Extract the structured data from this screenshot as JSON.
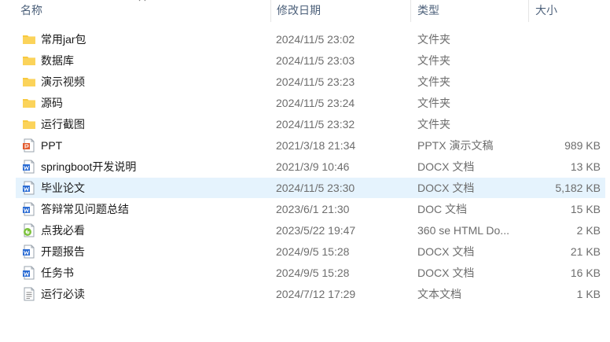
{
  "columns": {
    "name": "名称",
    "date": "修改日期",
    "type": "类型",
    "size": "大小"
  },
  "icons": {
    "folder": "folder-icon",
    "pptx": "pptx-file-icon",
    "docx": "docx-file-icon",
    "doc": "doc-file-icon",
    "html": "html-file-icon",
    "txt": "text-file-icon",
    "sort": "sort-up-icon"
  },
  "colors": {
    "selected_row": "#e5f3fd",
    "folder": "#f8c93e",
    "word": "#2b6cd4",
    "ppt": "#e35b2e",
    "html": "#7cc23c"
  },
  "files": [
    {
      "name": "常用jar包",
      "date": "2024/11/5 23:02",
      "type": "文件夹",
      "size": "",
      "kind": "folder",
      "selected": false
    },
    {
      "name": "数据库",
      "date": "2024/11/5 23:03",
      "type": "文件夹",
      "size": "",
      "kind": "folder",
      "selected": false
    },
    {
      "name": "演示视频",
      "date": "2024/11/5 23:23",
      "type": "文件夹",
      "size": "",
      "kind": "folder",
      "selected": false
    },
    {
      "name": "源码",
      "date": "2024/11/5 23:24",
      "type": "文件夹",
      "size": "",
      "kind": "folder",
      "selected": false
    },
    {
      "name": "运行截图",
      "date": "2024/11/5 23:32",
      "type": "文件夹",
      "size": "",
      "kind": "folder",
      "selected": false
    },
    {
      "name": "PPT",
      "date": "2021/3/18 21:34",
      "type": "PPTX 演示文稿",
      "size": "989 KB",
      "kind": "pptx",
      "selected": false
    },
    {
      "name": "springboot开发说明",
      "date": "2021/3/9 10:46",
      "type": "DOCX 文档",
      "size": "13 KB",
      "kind": "docx",
      "selected": false
    },
    {
      "name": "毕业论文",
      "date": "2024/11/5 23:30",
      "type": "DOCX 文档",
      "size": "5,182 KB",
      "kind": "docx",
      "selected": true
    },
    {
      "name": "答辩常见问题总结",
      "date": "2023/6/1 21:30",
      "type": "DOC 文档",
      "size": "15 KB",
      "kind": "doc",
      "selected": false
    },
    {
      "name": "点我必看",
      "date": "2023/5/22 19:47",
      "type": "360 se HTML Do...",
      "size": "2 KB",
      "kind": "html",
      "selected": false
    },
    {
      "name": "开题报告",
      "date": "2024/9/5 15:28",
      "type": "DOCX 文档",
      "size": "21 KB",
      "kind": "docx",
      "selected": false
    },
    {
      "name": "任务书",
      "date": "2024/9/5 15:28",
      "type": "DOCX 文档",
      "size": "16 KB",
      "kind": "docx",
      "selected": false
    },
    {
      "name": "运行必读",
      "date": "2024/7/12 17:29",
      "type": "文本文档",
      "size": "1 KB",
      "kind": "txt",
      "selected": false
    }
  ]
}
